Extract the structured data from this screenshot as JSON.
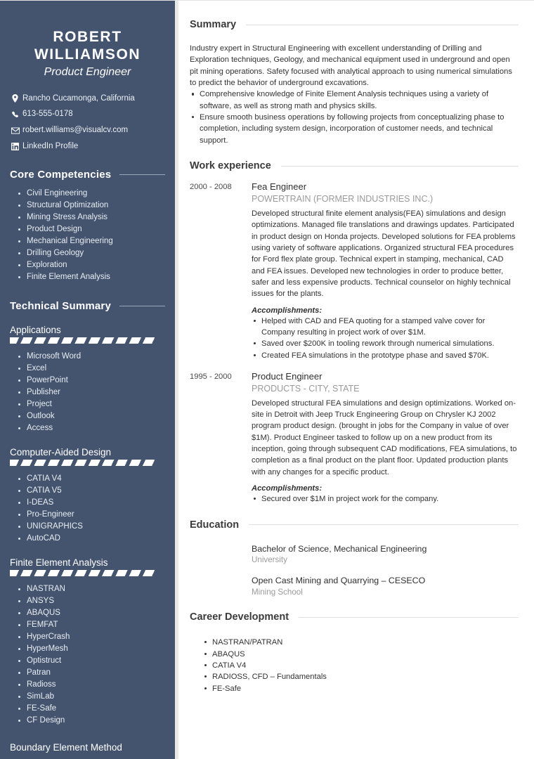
{
  "sidebar": {
    "name": "ROBERT WILLIAMSON",
    "name_line1": "ROBERT",
    "name_line2": "WILLIAMSON",
    "job_title": "Product Engineer",
    "contacts": [
      {
        "icon": "map-pin-icon",
        "text": "Rancho Cucamonga, California"
      },
      {
        "icon": "phone-icon",
        "text": "613-555-0178"
      },
      {
        "icon": "envelope-icon",
        "text": "robert.williams@visualcv.com"
      },
      {
        "icon": "linkedin-icon",
        "text": "LinkedIn Profile"
      }
    ],
    "core_competencies": {
      "heading": "Core Competencies",
      "items": [
        "Civil Engineering",
        "Structural Optimization",
        "Mining Stress Analysis",
        "Product Design",
        "Mechanical Engineering",
        "Drilling Geology",
        "Exploration",
        "Finite Element Analysis"
      ]
    },
    "technical_summary": {
      "heading": "Technical Summary",
      "groups": [
        {
          "title": "Applications",
          "items": [
            "Microsoft Word",
            "Excel",
            "PowerPoint",
            "Publisher",
            "Project",
            "Outlook",
            "Access"
          ]
        },
        {
          "title": "Computer-Aided Design",
          "items": [
            "CATIA V4",
            "CATIA V5",
            "I-DEAS",
            "Pro-Engineer",
            "UNIGRAPHICS",
            "AutoCAD"
          ]
        },
        {
          "title": "Finite Element Analysis",
          "items": [
            "NASTRAN",
            "ANSYS",
            "ABAQUS",
            "FEMFAT",
            "HyperCrash",
            "HyperMesh",
            "Optistruct",
            "Patran",
            "Radioss",
            "SimLab",
            "FE-Safe",
            "CF Design"
          ]
        }
      ],
      "last_group_title": "Boundary Element Method"
    }
  },
  "main": {
    "summary": {
      "heading": "Summary",
      "paragraph": "Industry expert in Structural Engineering with excellent understanding of Drilling and Exploration techniques, Geology, and mechanical equipment used in underground and open pit mining operations. Safety focused with analytical approach to using numerical simulations to predict the behavior of underground excavations.",
      "bullets": [
        "Comprehensive knowledge of Finite Element Analysis techniques using a variety of software, as well as strong math and physics skills.",
        "Ensure smooth business operations by following projects from conceptualizing phase to completion, including system design, incorporation of customer needs, and technical support."
      ]
    },
    "work_experience": {
      "heading": "Work experience",
      "accomplishments_label": "Accomplishments:",
      "jobs": [
        {
          "dates": "2000 - 2008",
          "role": "Fea Engineer",
          "company": "POWERTRAIN (FORMER INDUSTRIES INC.)",
          "description": "Developed structural finite element analysis(FEA) simulations and design optimizations. Managed file translations and drawings updates. Participated in product design on Honda projects. Developed solutions for FEA problems using variety of software applications. Organized structural FEA procedures for Ford flex plate group. Technical expert in stamping, mechanical, CAD and FEA issues. Developed new technologies in order to produce better, safer and less expensive products. Technical counselor on highly technical issues for the plants.",
          "accomplishments": [
            "Helped with CAD and FEA quoting for a stamped valve cover for Company resulting in project work of over $1M.",
            "Saved over $200K in tooling rework through numerical simulations.",
            "Created FEA simulations in the prototype phase and saved $70K."
          ]
        },
        {
          "dates": "1995 - 2000",
          "role": "Product Engineer",
          "company": "PRODUCTS - CITY, STATE",
          "description": "Developed structural FEA simulations and design optimizations. Worked on-site in Detroit with Jeep Truck Engineering Group on Chrysler KJ 2002 program product design. (brought in jobs for the Company in value of over $1M). Product Engineer tasked to follow up on a new product from its inception, going through subsequent CAD modifications, FEA simulations, to completion as a final product on the plant floor. Updated production plants with any changes for a specific product.",
          "accomplishments": [
            "Secured over $1M in project work for the company."
          ]
        }
      ]
    },
    "education": {
      "heading": "Education",
      "items": [
        {
          "degree": "Bachelor of Science, Mechanical Engineering",
          "school": "University"
        },
        {
          "degree": "Open Cast Mining and Quarrying – CESECO",
          "school": "Mining School"
        }
      ]
    },
    "career_development": {
      "heading": "Career Development",
      "items": [
        "NASTRAN/PATRAN",
        "ABAQUS",
        "CATIA V4",
        "RADIOSS, CFD – Fundamentals",
        "FE-Safe"
      ]
    }
  },
  "colors": {
    "sidebar_bg": "#44546f",
    "heading_dark": "#3b3b3b",
    "muted_gray": "#9a9a9a"
  }
}
